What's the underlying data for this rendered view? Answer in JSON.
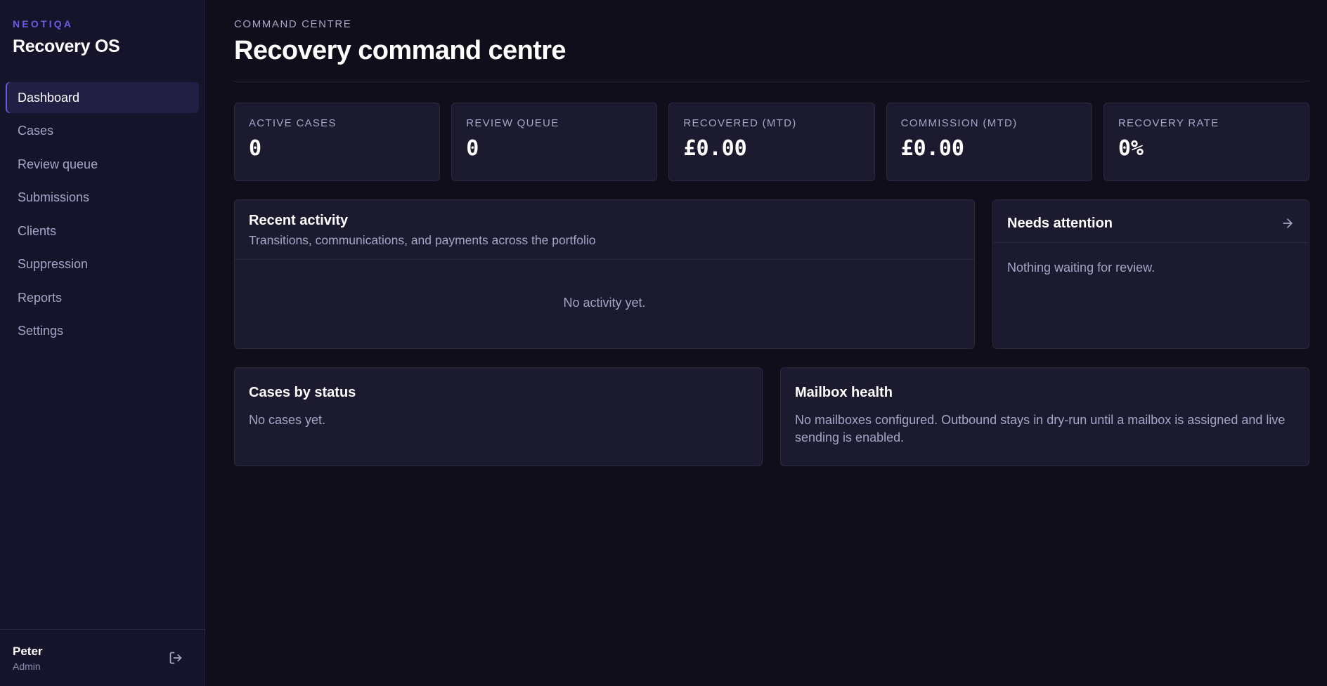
{
  "brand": {
    "kicker": "NEOTIQA",
    "title": "Recovery OS",
    "accent_color": "#6b5ce7"
  },
  "nav": {
    "items": [
      {
        "label": "Dashboard",
        "active": true
      },
      {
        "label": "Cases"
      },
      {
        "label": "Review queue"
      },
      {
        "label": "Submissions"
      },
      {
        "label": "Clients"
      },
      {
        "label": "Suppression"
      },
      {
        "label": "Reports"
      },
      {
        "label": "Settings"
      }
    ]
  },
  "user": {
    "name": "Peter",
    "role": "Admin",
    "logout_icon": "logout-icon"
  },
  "header": {
    "kicker": "COMMAND CENTRE",
    "title": "Recovery command centre"
  },
  "stats": [
    {
      "label": "ACTIVE CASES",
      "value": "0"
    },
    {
      "label": "REVIEW QUEUE",
      "value": "0"
    },
    {
      "label": "RECOVERED (MTD)",
      "value": "£0.00"
    },
    {
      "label": "COMMISSION (MTD)",
      "value": "£0.00"
    },
    {
      "label": "RECOVERY RATE",
      "value": "0%"
    }
  ],
  "recent_activity": {
    "title": "Recent activity",
    "subtitle": "Transitions, communications, and payments across the portfolio",
    "empty": "No activity yet."
  },
  "needs_attention": {
    "title": "Needs attention",
    "empty": "Nothing waiting for review.",
    "arrow_icon": "arrow-right-icon"
  },
  "cases_by_status": {
    "title": "Cases by status",
    "empty": "No cases yet."
  },
  "mailbox_health": {
    "title": "Mailbox health",
    "text": "No mailboxes configured. Outbound stays in dry-run until a mailbox is assigned and live sending is enabled."
  }
}
